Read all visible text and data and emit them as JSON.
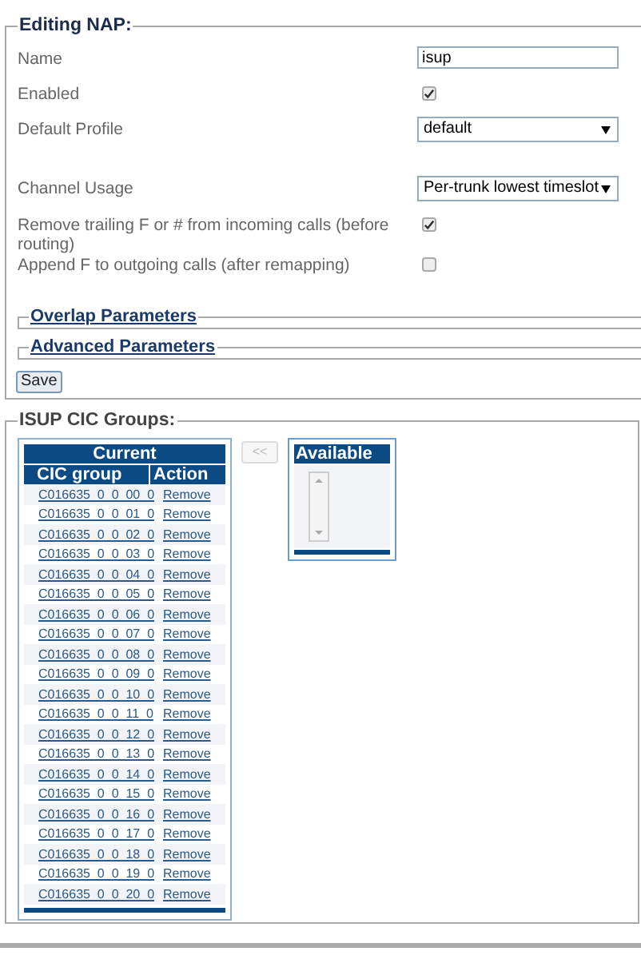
{
  "editing_nap": {
    "legend": "Editing NAP:",
    "fields": [
      {
        "label": "Name",
        "kind": "text",
        "value": "isup"
      },
      {
        "label": "Enabled",
        "kind": "checkbox",
        "checked": true
      },
      {
        "label": "Default Profile",
        "kind": "select",
        "value": "default"
      },
      {
        "label": "Channel Usage",
        "kind": "select",
        "value": "Per-trunk lowest timeslot"
      },
      {
        "label": "Remove trailing F or # from incoming calls (before routing)",
        "kind": "checkbox",
        "checked": true
      },
      {
        "label": "Append F to outgoing calls (after remapping)",
        "kind": "checkbox",
        "checked": false
      }
    ],
    "sections": [
      {
        "legend": "Overlap Parameters",
        "expanded": false
      },
      {
        "legend": "Advanced Parameters",
        "expanded": false
      }
    ],
    "save_button": "Save"
  },
  "cic_groups": {
    "legend": "ISUP CIC Groups:",
    "current": {
      "title": "Current",
      "columns": [
        "CIC group",
        "Action"
      ],
      "rows": [
        {
          "group": "C016635_0_0_00_0",
          "action": "Remove"
        },
        {
          "group": "C016635_0_0_01_0",
          "action": "Remove"
        },
        {
          "group": "C016635_0_0_02_0",
          "action": "Remove"
        },
        {
          "group": "C016635_0_0_03_0",
          "action": "Remove"
        },
        {
          "group": "C016635_0_0_04_0",
          "action": "Remove"
        },
        {
          "group": "C016635_0_0_05_0",
          "action": "Remove"
        },
        {
          "group": "C016635_0_0_06_0",
          "action": "Remove"
        },
        {
          "group": "C016635_0_0_07_0",
          "action": "Remove"
        },
        {
          "group": "C016635_0_0_08_0",
          "action": "Remove"
        },
        {
          "group": "C016635_0_0_09_0",
          "action": "Remove"
        },
        {
          "group": "C016635_0_0_10_0",
          "action": "Remove"
        },
        {
          "group": "C016635_0_0_11_0",
          "action": "Remove"
        },
        {
          "group": "C016635_0_0_12_0",
          "action": "Remove"
        },
        {
          "group": "C016635_0_0_13_0",
          "action": "Remove"
        },
        {
          "group": "C016635_0_0_14_0",
          "action": "Remove"
        },
        {
          "group": "C016635_0_0_15_0",
          "action": "Remove"
        },
        {
          "group": "C016635_0_0_16_0",
          "action": "Remove"
        },
        {
          "group": "C016635_0_0_17_0",
          "action": "Remove"
        },
        {
          "group": "C016635_0_0_18_0",
          "action": "Remove"
        },
        {
          "group": "C016635_0_0_19_0",
          "action": "Remove"
        },
        {
          "group": "C016635_0_0_20_0",
          "action": "Remove"
        }
      ]
    },
    "move_button": {
      "label": "<<",
      "disabled": true
    },
    "available": {
      "title": "Available"
    }
  }
}
